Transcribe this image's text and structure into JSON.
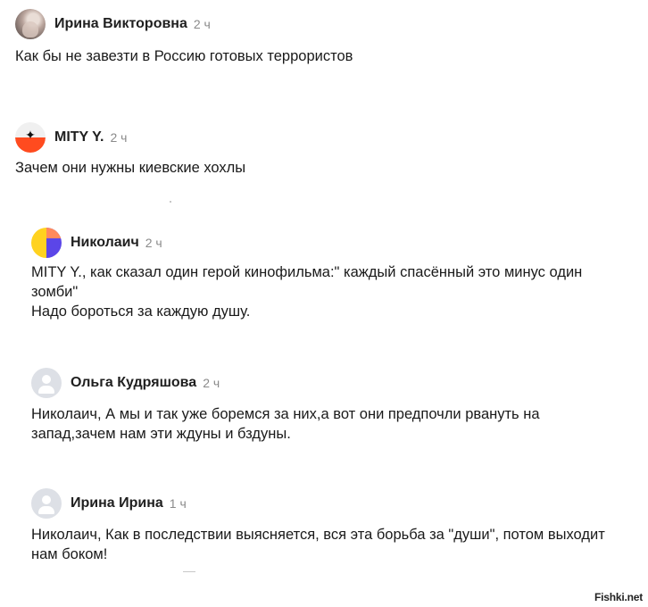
{
  "comments": [
    {
      "author": "Ирина Викторовна",
      "time": "2 ч",
      "text": "Как бы не завезти в Россию готовых террористов"
    },
    {
      "author": "MITY Y.",
      "time": "2 ч",
      "text": "Зачем они нужны киевские хохлы"
    },
    {
      "author": "Николаич",
      "time": "2 ч",
      "text": "MITY Y., как сказал один герой кинофильма:\" каждый спасённый это минус один\nзомби\"\nНадо бороться за каждую душу."
    },
    {
      "author": "Ольга Кудряшова",
      "time": "2 ч",
      "text": "Николаич, А мы и так уже боремся за них,а вот они предпочли рвануть на\nзапад,зачем нам эти ждуны и бздуны."
    },
    {
      "author": "Ирина Ирина",
      "time": "1 ч",
      "text": "Николаич, Как в последствии выясняется, вся эта борьба за \"души\", потом выходит\nнам боком!"
    }
  ],
  "watermark": "Fishki.net",
  "icons": {
    "mity_avatar_glyph": "✦"
  }
}
